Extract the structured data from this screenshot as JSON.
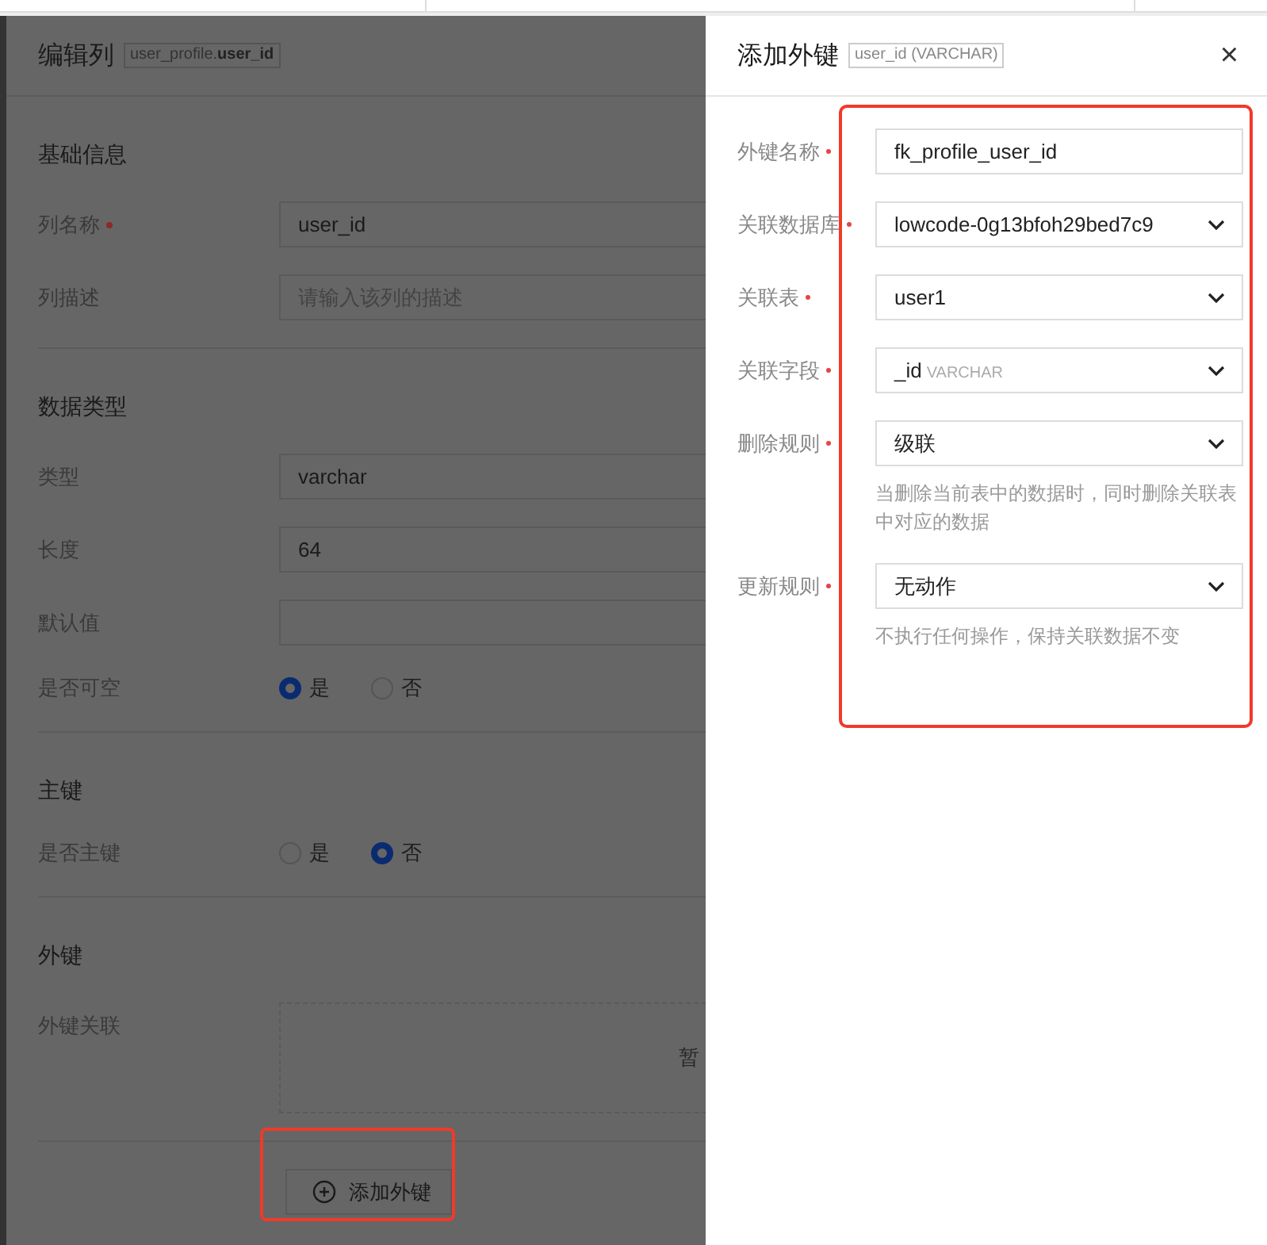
{
  "edit_panel": {
    "title": "编辑列",
    "tag": "user_profile.**user_id**",
    "sections": [
      {
        "title": "基础信息",
        "fields": [
          {
            "label": "列名称",
            "required": true,
            "kind": "input",
            "value": "user_id"
          },
          {
            "label": "列描述",
            "required": false,
            "kind": "input",
            "placeholder": "请输入该列的描述"
          }
        ]
      },
      {
        "title": "数据类型",
        "fields": [
          {
            "label": "类型",
            "required": false,
            "kind": "input",
            "value": "varchar"
          },
          {
            "label": "长度",
            "required": false,
            "kind": "input",
            "value": "64"
          },
          {
            "label": "默认值",
            "required": false,
            "kind": "input"
          },
          {
            "label": "是否可空",
            "required": false,
            "kind": "radio",
            "options": [
              {
                "label": "是",
                "selected": true
              },
              {
                "label": "否",
                "selected": false
              }
            ]
          }
        ]
      },
      {
        "title": "主键",
        "fields": [
          {
            "label": "是否主键",
            "required": false,
            "kind": "radio",
            "options": [
              {
                "label": "是",
                "selected": false
              },
              {
                "label": "否",
                "selected": true
              }
            ]
          }
        ]
      },
      {
        "title": "外键",
        "fields": [
          {
            "label": "外键关联",
            "required": false,
            "kind": "empty_list",
            "empty_text": "暂"
          }
        ]
      }
    ],
    "add_button": {
      "label": "添加外键",
      "highlighted": true
    }
  },
  "drawer": {
    "title": "添加外键",
    "tag": "user_id (VARCHAR)",
    "close": "×",
    "highlighted": true,
    "fields": [
      {
        "label": "外键名称",
        "required": true,
        "kind": "input",
        "value": "fk_profile_user_id"
      },
      {
        "label": "关联数据库",
        "required": true,
        "kind": "select",
        "value": "lowcode-0g13bfoh29bed7c9"
      },
      {
        "label": "关联表",
        "required": true,
        "kind": "select",
        "value": "user1"
      },
      {
        "label": "关联字段",
        "required": true,
        "kind": "select",
        "value": "_id",
        "hint": "VARCHAR"
      },
      {
        "label": "删除规则",
        "required": true,
        "kind": "select",
        "value": "级联",
        "help": "当删除当前表中的数据时，同时删除关联表中对应的数据"
      },
      {
        "label": "更新规则",
        "required": true,
        "kind": "select",
        "value": "无动作",
        "help": "不执行任何操作，保持关联数据不变"
      }
    ]
  }
}
